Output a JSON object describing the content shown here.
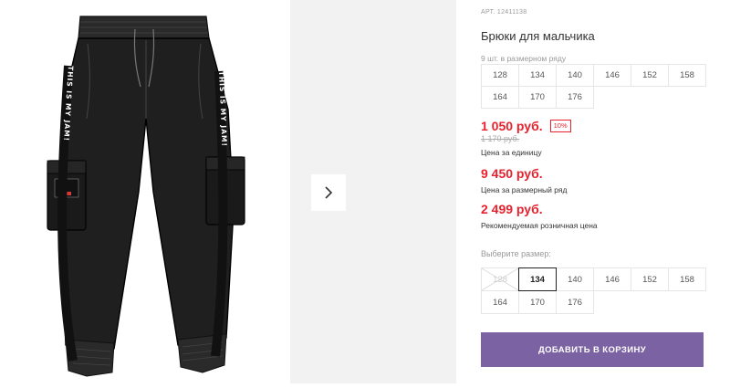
{
  "product": {
    "article": "АРТ. 12411138",
    "title": "Брюки для мальчика",
    "image_print_text": "THIS IS MY JAM!"
  },
  "pack": {
    "note": "9 шт. в размерном ряду",
    "row1": [
      "128",
      "134",
      "140",
      "146",
      "152",
      "158"
    ],
    "row2": [
      "164",
      "170",
      "176"
    ]
  },
  "prices": {
    "unit": "1 050 руб.",
    "discount_badge": "10%",
    "old": "1 170 руб.",
    "unit_caption": "Цена за единицу",
    "pack": "9 450 руб.",
    "pack_caption": "Цена за размерный ряд",
    "retail": "2 499 руб.",
    "retail_caption": "Рекомендуемая розничная цена"
  },
  "size_select": {
    "label": "Выберите размер:",
    "row1": [
      "128",
      "134",
      "140",
      "146",
      "152",
      "158"
    ],
    "row2": [
      "164",
      "170",
      "176"
    ],
    "disabled": "128",
    "selected": "134"
  },
  "cart": {
    "add_label": "ДОБАВИТЬ В КОРЗИНУ"
  },
  "colors": {
    "accent": "#7b62a3",
    "price_red": "#e8222e",
    "thumb_bg": "#f2f2f2"
  },
  "icons": {
    "next": "chevron-right-icon"
  }
}
